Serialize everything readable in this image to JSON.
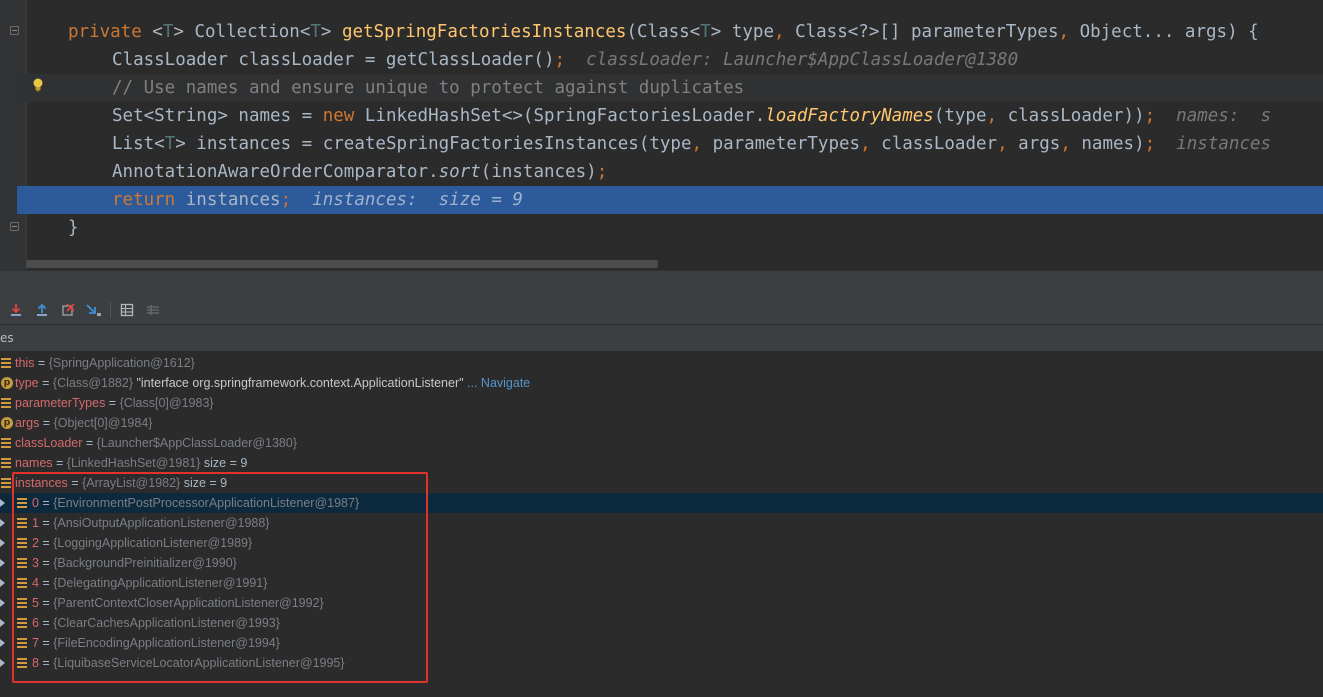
{
  "editor": {
    "lines": [
      {
        "parts": [
          [
            "private ",
            "kw"
          ],
          [
            "<",
            ""
          ],
          [
            "T",
            "tp"
          ],
          [
            "> Collection<",
            ""
          ],
          [
            "T",
            "tp"
          ],
          [
            "> ",
            ""
          ],
          [
            "getSpringFactoriesInstances",
            "fn"
          ],
          [
            "(Class<",
            ""
          ],
          [
            "T",
            "tp"
          ],
          [
            "> type",
            ""
          ],
          [
            ", ",
            "punc"
          ],
          [
            "Class<?>[] parameterTypes",
            ""
          ],
          [
            ", ",
            "punc"
          ],
          [
            "Object... args) {",
            ""
          ]
        ]
      },
      {
        "parts": [
          [
            "ClassLoader classLoader = getClassLoader()",
            ""
          ],
          [
            ";",
            "punc"
          ],
          [
            "  classLoader: Launcher$AppClassLoader@1380",
            "hint"
          ]
        ]
      },
      {
        "parts": [
          [
            "// Use names and ensure unique to protect against duplicates",
            "cm"
          ]
        ]
      },
      {
        "parts": [
          [
            "Set<String> names = ",
            ""
          ],
          [
            "new ",
            "kw"
          ],
          [
            "LinkedHashSet<>(SpringFactoriesLoader.",
            ""
          ],
          [
            "loadFactoryNames",
            "fn it"
          ],
          [
            "(type",
            ""
          ],
          [
            ", ",
            "punc"
          ],
          [
            "classLoader))",
            ""
          ],
          [
            ";",
            "punc"
          ],
          [
            "  names:  s",
            "hint"
          ]
        ]
      },
      {
        "parts": [
          [
            "List<",
            ""
          ],
          [
            "T",
            "tp"
          ],
          [
            "> instances = createSpringFactoriesInstances(type",
            ""
          ],
          [
            ", ",
            "punc"
          ],
          [
            "parameterTypes",
            ""
          ],
          [
            ", ",
            "punc"
          ],
          [
            "classLoader",
            ""
          ],
          [
            ", ",
            "punc"
          ],
          [
            "args",
            ""
          ],
          [
            ", ",
            "punc"
          ],
          [
            "names)",
            ""
          ],
          [
            ";",
            "punc"
          ],
          [
            "  instances",
            "hint"
          ]
        ]
      },
      {
        "parts": [
          [
            "AnnotationAwareOrderComparator.",
            ""
          ],
          [
            "sort",
            "it"
          ],
          [
            "(instances)",
            ""
          ],
          [
            ";",
            "punc"
          ]
        ]
      },
      {
        "parts": [
          [
            "return ",
            "kw"
          ],
          [
            "instances",
            ""
          ],
          [
            ";",
            "punc"
          ],
          [
            "  instances:  size = 9",
            "hint-exec"
          ]
        ]
      },
      {
        "parts": [
          [
            "}",
            ""
          ]
        ]
      }
    ]
  },
  "panel": {
    "header_label": "es"
  },
  "variables": [
    {
      "name": "this",
      "ref": "{SpringApplication@1612}",
      "extra": "",
      "icon": "field"
    },
    {
      "name": "type",
      "ref": "{Class@1882}",
      "str": " \"interface org.springframework.context.ApplicationListener\"",
      "link": " ... Navigate",
      "icon": "param"
    },
    {
      "name": "parameterTypes",
      "ref": "{Class[0]@1983}",
      "extra": "",
      "icon": "field"
    },
    {
      "name": "args",
      "ref": "{Object[0]@1984}",
      "extra": "",
      "icon": "param"
    },
    {
      "name": "classLoader",
      "ref": "{Launcher$AppClassLoader@1380}",
      "extra": "",
      "icon": "field"
    },
    {
      "name": "names",
      "ref": "{LinkedHashSet@1981}",
      "extra": "  size = 9",
      "icon": "field"
    },
    {
      "name": "instances",
      "ref": "{ArrayList@1982}",
      "extra": "  size = 9",
      "icon": "field"
    }
  ],
  "instances": [
    {
      "index": "0",
      "ref": "{EnvironmentPostProcessorApplicationListener@1987}"
    },
    {
      "index": "1",
      "ref": "{AnsiOutputApplicationListener@1988}"
    },
    {
      "index": "2",
      "ref": "{LoggingApplicationListener@1989}"
    },
    {
      "index": "3",
      "ref": "{BackgroundPreinitializer@1990}"
    },
    {
      "index": "4",
      "ref": "{DelegatingApplicationListener@1991}"
    },
    {
      "index": "5",
      "ref": "{ParentContextCloserApplicationListener@1992}"
    },
    {
      "index": "6",
      "ref": "{ClearCachesApplicationListener@1993}"
    },
    {
      "index": "7",
      "ref": "{FileEncodingApplicationListener@1994}"
    },
    {
      "index": "8",
      "ref": "{LiquibaseServiceLocatorApplicationListener@1995}"
    }
  ],
  "colors": {
    "execution_line": "#2d5a9b",
    "highlight_box": "#e0332b"
  }
}
